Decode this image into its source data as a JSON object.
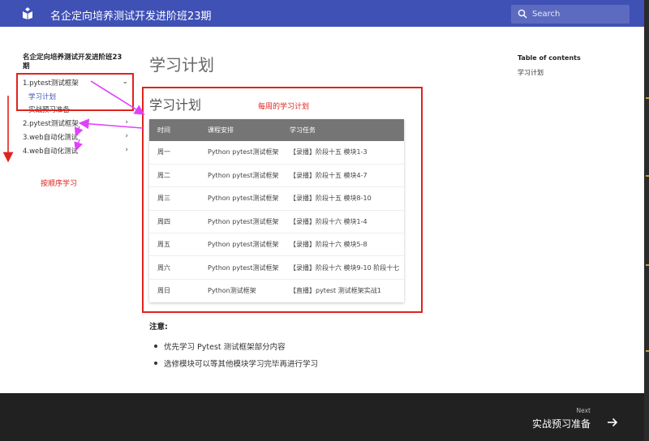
{
  "header": {
    "site_title": "名企定向培养测试开发进阶班23期",
    "search_placeholder": "Search"
  },
  "sidebar": {
    "title": "名企定向培养测试开发进阶班23期",
    "items": [
      {
        "label": "1.pytest测试框架",
        "chevron": "⌄",
        "expanded": true
      },
      {
        "label": "2.pytest测试框架",
        "chevron": "›"
      },
      {
        "label": "3.web自动化测试",
        "chevron": "›"
      },
      {
        "label": "4.web自动化测试",
        "chevron": "›"
      }
    ],
    "sub_items": [
      {
        "label": "学习计划",
        "active": true
      },
      {
        "label": "实战预习准备",
        "active": false
      }
    ]
  },
  "annotations": {
    "weekly_plan": "每周的学习计划",
    "study_in_order": "按顺序学习",
    "color": "#e0231d"
  },
  "main": {
    "title": "学习计划",
    "box_title": "学习计划",
    "table": {
      "headers": [
        "时间",
        "课程安排",
        "学习任务"
      ],
      "rows": [
        [
          "周一",
          "Python pytest测试框架",
          "【录播】阶段十五 模块1-3"
        ],
        [
          "周二",
          "Python pytest测试框架",
          "【录播】阶段十五 模块4-7"
        ],
        [
          "周三",
          "Python pytest测试框架",
          "【录播】阶段十五 模块8-10"
        ],
        [
          "周四",
          "Python pytest测试框架",
          "【录播】阶段十六 模块1-4"
        ],
        [
          "周五",
          "Python pytest测试框架",
          "【录播】阶段十六 模块5-8"
        ],
        [
          "周六",
          "Python pytest测试框架",
          "【录播】阶段十六 模块9-10 阶段十七"
        ],
        [
          "周日",
          "Python测试框架",
          "【直播】pytest 测试框架实战1"
        ]
      ]
    },
    "note_title": "注意:",
    "notes": [
      "优先学习 Pytest 测试框架部分内容",
      "选修模块可以等其他模块学习完毕再进行学习"
    ]
  },
  "toc": {
    "title": "Table of contents",
    "items": [
      "学习计划"
    ]
  },
  "footer": {
    "next_label": "Next",
    "next_title": "实战预习准备"
  },
  "colors": {
    "primary": "#3f51b5",
    "search_bg": "#5c6bc0",
    "footer_bg": "#212121",
    "table_header": "#757575"
  },
  "icons": {
    "logo": "book-logo-icon",
    "search": "search-icon",
    "next": "arrow-right-icon"
  }
}
